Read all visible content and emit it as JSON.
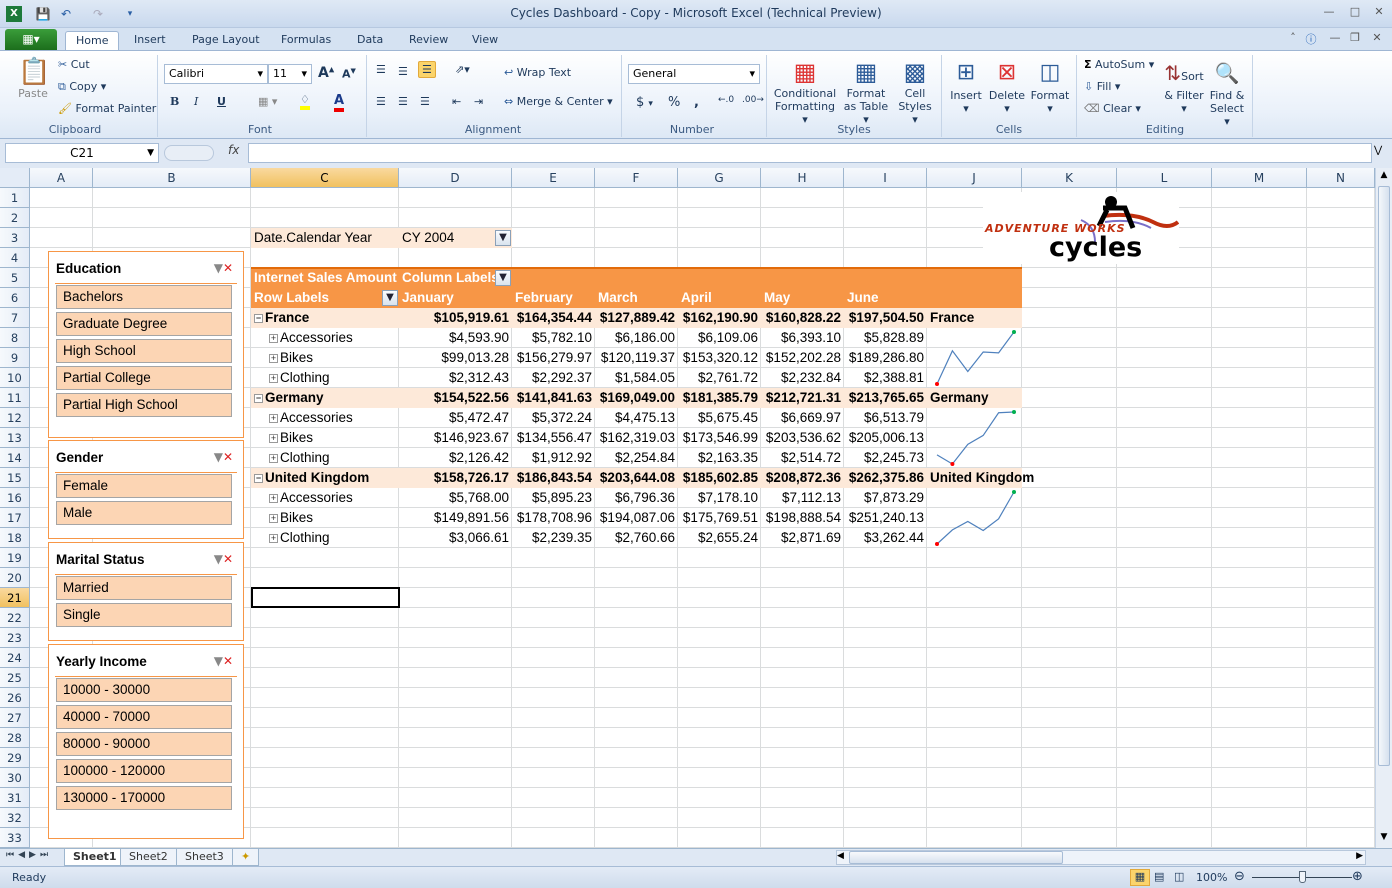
{
  "window": {
    "title": "Cycles Dashboard - Copy  -  Microsoft Excel (Technical Preview)"
  },
  "ribbon_tabs": [
    "Home",
    "Insert",
    "Page Layout",
    "Formulas",
    "Data",
    "Review",
    "View"
  ],
  "active_tab": "Home",
  "ribbon": {
    "clipboard": {
      "label": "Clipboard",
      "paste": "Paste",
      "cut": "Cut",
      "copy": "Copy",
      "format_painter": "Format Painter"
    },
    "font": {
      "label": "Font",
      "name": "Calibri",
      "size": "11",
      "bold": "B",
      "italic": "I",
      "underline": "U"
    },
    "alignment": {
      "label": "Alignment",
      "wrap": "Wrap Text",
      "merge": "Merge & Center"
    },
    "number": {
      "label": "Number",
      "format": "General",
      "currency": "$",
      "percent": "%",
      "comma": ","
    },
    "styles": {
      "label": "Styles",
      "conditional": "Conditional Formatting",
      "format_table": "Format as Table",
      "cell_styles": "Cell Styles"
    },
    "cells": {
      "label": "Cells",
      "insert": "Insert",
      "delete": "Delete",
      "format": "Format"
    },
    "editing": {
      "label": "Editing",
      "autosum": "AutoSum",
      "fill": "Fill",
      "clear": "Clear",
      "sort": "Sort & Filter",
      "find": "Find & Select"
    }
  },
  "formula_bar": {
    "name_box": "C21",
    "fx": "fx",
    "formula": ""
  },
  "columns": [
    "A",
    "B",
    "C",
    "D",
    "E",
    "F",
    "G",
    "H",
    "I",
    "J",
    "K",
    "L",
    "M",
    "N"
  ],
  "rows": [
    "1",
    "2",
    "3",
    "4",
    "5",
    "6",
    "7",
    "8",
    "9",
    "10",
    "11",
    "12",
    "13",
    "14",
    "15",
    "16",
    "17",
    "18",
    "19",
    "20",
    "21",
    "22",
    "23",
    "24",
    "25",
    "26",
    "27",
    "28",
    "29",
    "30",
    "31",
    "32",
    "33"
  ],
  "selected_cell": "C21",
  "report_filter": {
    "field": "Date.Calendar Year",
    "value": "CY 2004"
  },
  "pivot": {
    "measure": "Internet Sales Amount",
    "column_labels": "Column Labels",
    "row_labels": "Row Labels",
    "months": [
      "January",
      "February",
      "March",
      "April",
      "May",
      "June"
    ],
    "countries": [
      {
        "name": "France",
        "totals": [
          "$105,919.61",
          "$164,354.44",
          "$127,889.42",
          "$162,190.90",
          "$160,828.22",
          "$197,504.50"
        ],
        "categories": [
          {
            "name": "Accessories",
            "values": [
              "$4,593.90",
              "$5,782.10",
              "$6,186.00",
              "$6,109.06",
              "$6,393.10",
              "$5,828.89"
            ]
          },
          {
            "name": "Bikes",
            "values": [
              "$99,013.28",
              "$156,279.97",
              "$120,119.37",
              "$153,320.12",
              "$152,202.28",
              "$189,286.80"
            ]
          },
          {
            "name": "Clothing",
            "values": [
              "$2,312.43",
              "$2,292.37",
              "$1,584.05",
              "$2,761.72",
              "$2,232.84",
              "$2,388.81"
            ]
          }
        ]
      },
      {
        "name": "Germany",
        "totals": [
          "$154,522.56",
          "$141,841.63",
          "$169,049.00",
          "$181,385.79",
          "$212,721.31",
          "$213,765.65"
        ],
        "categories": [
          {
            "name": "Accessories",
            "values": [
              "$5,472.47",
              "$5,372.24",
              "$4,475.13",
              "$5,675.45",
              "$6,669.97",
              "$6,513.79"
            ]
          },
          {
            "name": "Bikes",
            "values": [
              "$146,923.67",
              "$134,556.47",
              "$162,319.03",
              "$173,546.99",
              "$203,536.62",
              "$205,006.13"
            ]
          },
          {
            "name": "Clothing",
            "values": [
              "$2,126.42",
              "$1,912.92",
              "$2,254.84",
              "$2,163.35",
              "$2,514.72",
              "$2,245.73"
            ]
          }
        ]
      },
      {
        "name": "United Kingdom",
        "totals": [
          "$158,726.17",
          "$186,843.54",
          "$203,644.08",
          "$185,602.85",
          "$208,872.36",
          "$262,375.86"
        ],
        "categories": [
          {
            "name": "Accessories",
            "values": [
              "$5,768.00",
              "$5,895.23",
              "$6,796.36",
              "$7,178.10",
              "$7,112.13",
              "$7,873.29"
            ]
          },
          {
            "name": "Bikes",
            "values": [
              "$149,891.56",
              "$178,708.96",
              "$194,087.06",
              "$175,769.51",
              "$198,888.54",
              "$251,240.13"
            ]
          },
          {
            "name": "Clothing",
            "values": [
              "$3,066.61",
              "$2,239.35",
              "$2,760.66",
              "$2,655.24",
              "$2,871.69",
              "$3,262.44"
            ]
          }
        ]
      }
    ]
  },
  "sparkline_colors": {
    "line": "#4f81bd",
    "high": "#00b050",
    "low": "#ff0000"
  },
  "slicers": [
    {
      "title": "Education",
      "items": [
        "Bachelors",
        "Graduate Degree",
        "High School",
        "Partial College",
        "Partial High School"
      ]
    },
    {
      "title": "Gender",
      "items": [
        "Female",
        "Male"
      ]
    },
    {
      "title": "Marital Status",
      "items": [
        "Married",
        "Single"
      ]
    },
    {
      "title": "Yearly Income",
      "items": [
        "10000 - 30000",
        "40000 - 70000",
        "80000 - 90000",
        "100000 - 120000",
        "130000 - 170000"
      ]
    }
  ],
  "logo": {
    "line1": "ADVENTURE WORKS",
    "line2": "cycles"
  },
  "sheet_tabs": [
    "Sheet1",
    "Sheet2",
    "Sheet3"
  ],
  "active_sheet": "Sheet1",
  "status": {
    "text": "Ready",
    "zoom": "100%",
    "zoom_level": 100
  },
  "colors": {
    "pivot_header": "#f79646",
    "pivot_row": "#fde9d9",
    "slicer_item": "#fcd5b4",
    "slicer_border": "#f79646"
  }
}
